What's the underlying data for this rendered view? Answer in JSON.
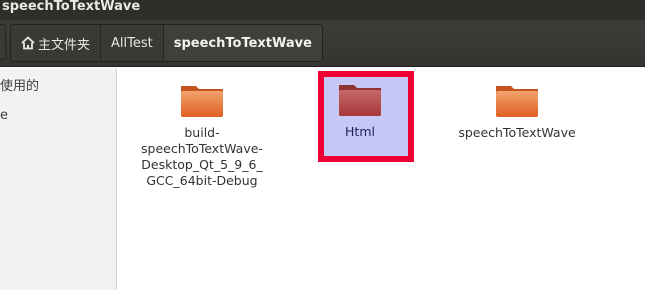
{
  "window": {
    "title": "speechToTextWave"
  },
  "pathbar": {
    "crumbs": [
      {
        "label": "主文件夹"
      },
      {
        "label": "AllTest"
      },
      {
        "label": "speechToTextWave"
      }
    ]
  },
  "sidebar": {
    "items": [
      {
        "label": "使用的"
      },
      {
        "label": "e"
      }
    ]
  },
  "files": [
    {
      "name_lines": [
        "build-",
        "speechToTextWave-",
        "Desktop_Qt_5_9_6_",
        "GCC_64bit-Debug"
      ]
    },
    {
      "name": "Html",
      "selected": true
    },
    {
      "name": "speechToTextWave"
    }
  ],
  "colors": {
    "folder_orange": "#e8743b",
    "folder_selected": "#b2524d",
    "selection_bg": "#c7c7f5",
    "highlight_border": "#ee0033"
  }
}
